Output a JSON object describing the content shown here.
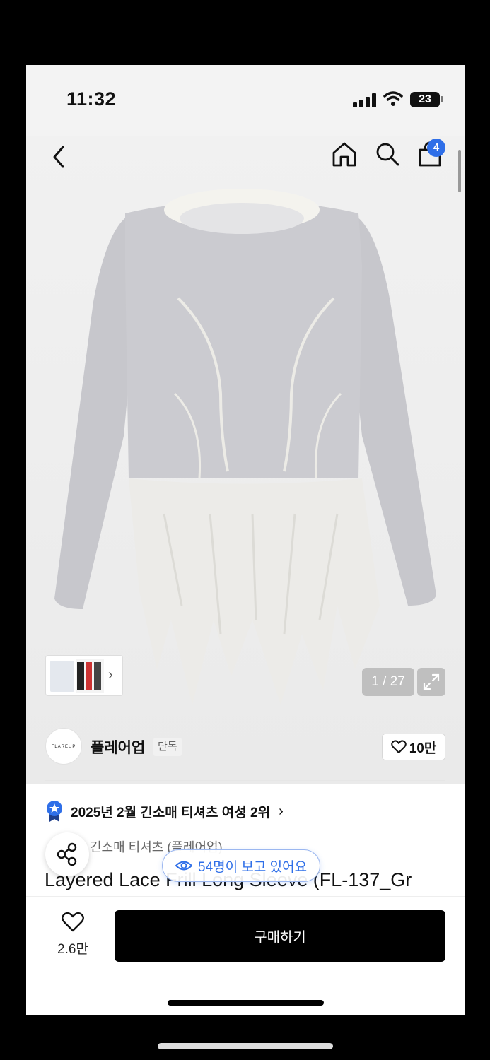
{
  "status_bar": {
    "time": "11:32",
    "battery": "23"
  },
  "nav": {
    "cart_count": "4"
  },
  "gallery": {
    "counter": "1 / 27"
  },
  "brand": {
    "name": "플레어업",
    "tag": "단독",
    "logo_text": "FLAREUP",
    "favorite_count": "10만"
  },
  "ranking": {
    "text": "2025년 2월 긴소매 티셔츠 여성 2위"
  },
  "product": {
    "category": "긴소매 티셔츠 (플레어업)",
    "title": "Layered Lace Frill Long Sleeve (FL-137_Gr",
    "viewers": "54명이 보고 있어요"
  },
  "bottom": {
    "like_count": "2.6만",
    "buy_label": "구매하기"
  },
  "colors": {
    "accent": "#2f6fe8",
    "buy_button": "#000000"
  }
}
